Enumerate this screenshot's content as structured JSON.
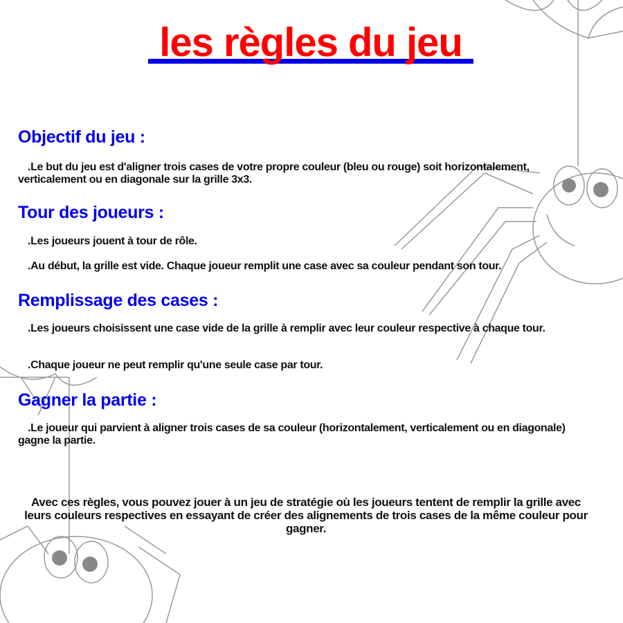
{
  "title": "les règles du jeu",
  "sections": [
    {
      "heading": "Objectif du jeu :",
      "paragraphs": [
        ".Le but du jeu est d'aligner trois cases de votre propre couleur (bleu ou rouge) soit horizontalement, verticalement ou en diagonale sur la grille 3x3."
      ]
    },
    {
      "heading": "Tour des joueurs :",
      "paragraphs": [
        ".Les joueurs jouent à tour de rôle.",
        ".Au début, la grille est vide. Chaque joueur remplit une case avec sa couleur pendant son tour."
      ]
    },
    {
      "heading": "Remplissage des cases :",
      "paragraphs": [
        ".Les joueurs choisissent une case vide de la grille à remplir avec leur couleur respective à chaque tour.",
        ".Chaque joueur ne peut remplir qu'une seule case par tour."
      ]
    },
    {
      "heading": "Gagner la partie :",
      "paragraphs": [
        ".Le joueur qui parvient à aligner trois cases de sa couleur (horizontalement, verticalement ou en diagonale) gagne la partie."
      ]
    }
  ],
  "closing": "Avec ces règles, vous pouvez jouer à un jeu de stratégie où les joueurs tentent de remplir la grille avec leurs couleurs respectives en essayant de créer des alignements de trois cases de la même couleur pour gagner.",
  "colors": {
    "title": "#ff0000",
    "underline": "#0000ee",
    "heading": "#0000ee",
    "text": "#111111"
  }
}
